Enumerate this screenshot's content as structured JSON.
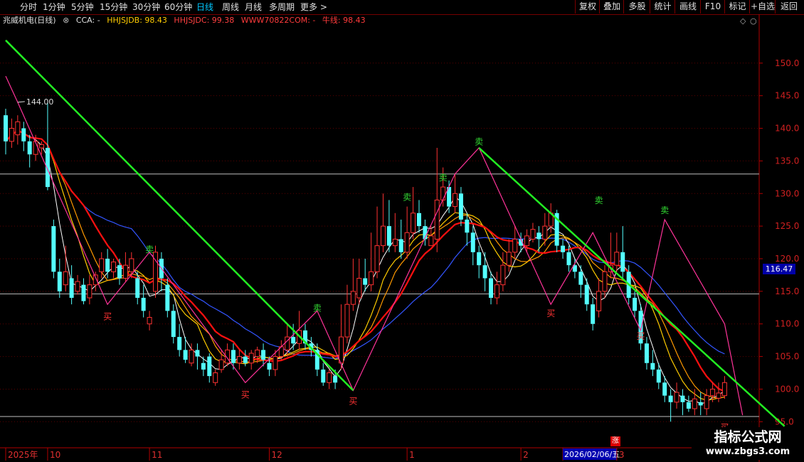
{
  "toolbar": {
    "tabs": [
      {
        "label": "分时",
        "active": false
      },
      {
        "label": "1分钟",
        "active": false
      },
      {
        "label": "5分钟",
        "active": false
      },
      {
        "label": "15分钟",
        "active": false
      },
      {
        "label": "30分钟",
        "active": false
      },
      {
        "label": "60分钟",
        "active": false
      },
      {
        "label": "日线",
        "active": true
      },
      {
        "label": "周线",
        "active": false
      },
      {
        "label": "月线",
        "active": false
      },
      {
        "label": "多周期",
        "active": false
      },
      {
        "label": "更多 >",
        "active": false
      }
    ],
    "right_buttons": [
      "复权",
      "叠加",
      "多股",
      "统计",
      "画线",
      "F10",
      "标记",
      "+自选",
      "返回"
    ]
  },
  "legend": {
    "stock": "兆威机电(日线)",
    "cca": "CCA: -",
    "hhjsjdb": "HHJSJDB: 98.43",
    "hhjsjdc": "HHJSJDC: 99.38",
    "www": "WWW70822COM: -",
    "niuxian": "牛线: 98.43"
  },
  "colors": {
    "up": "#ff3232",
    "down": "#54ffff",
    "trend_line": "#22ee22",
    "ma_red": "#ff1010",
    "ma_yellow": "#ffcc00",
    "ma_blue": "#3355ff",
    "ma_white": "#ffffff",
    "zigzag": "#ff3399",
    "axis": "#b00000"
  },
  "current_price": "116.47",
  "max_label": "144.00",
  "date_box": "2026/02/06/五",
  "zhang_badge": "涨",
  "watermark": {
    "title": "指标公式网",
    "url": "www.zbgs3.com"
  },
  "chart_data": {
    "type": "candlestick",
    "y_ticks": [
      150.0,
      145.0,
      140.0,
      135.0,
      130.0,
      125.0,
      120.0,
      115.0,
      110.0,
      105.0,
      100.0,
      95.0
    ],
    "ylim": [
      91.0,
      157.5
    ],
    "x_labels": [
      {
        "i": 0,
        "label": "2025年"
      },
      {
        "i": 7,
        "label": "10"
      },
      {
        "i": 24,
        "label": "11"
      },
      {
        "i": 44,
        "label": "12"
      },
      {
        "i": 67,
        "label": "1"
      },
      {
        "i": 86,
        "label": "2"
      },
      {
        "i": 93,
        "label": "2026/02/06/五"
      },
      {
        "i": 102,
        "label": "3"
      }
    ],
    "hlines": [
      133.0,
      114.6,
      95.8
    ],
    "candles": [
      [
        142,
        138,
        143,
        136
      ],
      [
        138,
        140,
        141.5,
        137
      ],
      [
        139,
        141,
        142,
        137.5
      ],
      [
        140,
        138,
        141,
        136.5
      ],
      [
        138,
        136,
        139,
        134
      ],
      [
        136,
        138,
        139,
        135
      ],
      [
        137,
        137.5,
        138,
        136
      ],
      [
        137,
        131,
        144,
        130.5
      ],
      [
        125,
        118,
        126,
        117
      ],
      [
        118,
        115,
        120,
        114
      ],
      [
        116,
        118,
        122,
        115
      ],
      [
        117,
        114,
        119,
        113
      ],
      [
        115,
        116.5,
        117.5,
        114.5
      ],
      [
        116,
        113.5,
        117,
        113
      ],
      [
        114,
        116,
        117.5,
        113
      ],
      [
        116,
        117.5,
        118,
        115
      ],
      [
        118,
        120,
        121,
        117
      ],
      [
        120,
        118,
        121.5,
        117
      ],
      [
        118,
        119.5,
        120,
        117
      ],
      [
        119,
        117,
        120,
        116
      ],
      [
        117,
        119,
        121,
        116.5
      ],
      [
        118,
        120,
        121,
        117
      ],
      [
        117,
        114,
        118,
        113
      ],
      [
        114,
        112,
        116,
        111
      ],
      [
        110,
        111,
        112,
        109
      ],
      [
        115,
        121,
        122,
        114
      ],
      [
        120,
        117,
        121,
        115
      ],
      [
        116,
        112,
        117,
        111
      ],
      [
        112,
        108,
        113,
        107
      ],
      [
        108,
        106,
        110,
        105
      ],
      [
        106,
        104.5,
        108,
        104
      ],
      [
        104,
        106,
        107,
        103.5
      ],
      [
        106,
        105,
        107,
        103
      ],
      [
        104,
        103,
        105,
        102
      ],
      [
        105,
        102,
        105.5,
        101
      ],
      [
        101,
        102.5,
        103,
        100.5
      ],
      [
        103,
        104.5,
        106,
        102.5
      ],
      [
        104,
        106,
        107,
        103.5
      ],
      [
        106,
        104,
        107,
        103
      ],
      [
        104,
        105,
        106,
        103
      ],
      [
        105,
        104,
        106,
        103.5
      ],
      [
        104,
        105.5,
        106,
        103
      ],
      [
        105,
        106,
        106.5,
        104
      ],
      [
        106,
        104.5,
        107,
        103.5
      ],
      [
        104,
        103,
        105,
        102
      ],
      [
        103,
        105,
        106,
        102
      ],
      [
        105,
        106.5,
        107.5,
        104.5
      ],
      [
        106,
        108,
        110,
        105
      ],
      [
        108,
        107,
        110,
        106
      ],
      [
        107,
        109,
        112,
        106
      ],
      [
        109,
        107,
        110,
        106
      ],
      [
        107,
        106,
        108,
        105
      ],
      [
        106,
        103,
        107,
        102
      ],
      [
        103,
        101,
        104,
        100.5
      ],
      [
        101,
        102.5,
        103,
        100
      ],
      [
        102,
        101,
        103,
        100
      ],
      [
        104,
        108,
        113,
        103
      ],
      [
        108,
        113,
        116,
        107
      ],
      [
        113,
        115,
        120,
        112
      ],
      [
        114,
        117,
        120,
        113
      ],
      [
        117,
        116,
        120,
        115
      ],
      [
        116,
        118,
        124,
        115
      ],
      [
        118,
        122,
        128,
        117
      ],
      [
        122,
        125,
        130,
        121
      ],
      [
        125,
        122,
        129,
        121
      ],
      [
        122,
        123,
        127,
        121
      ],
      [
        123,
        121,
        126,
        120
      ],
      [
        121,
        124,
        128,
        120
      ],
      [
        124,
        127,
        131,
        123
      ],
      [
        127,
        125,
        129,
        124
      ],
      [
        125,
        123,
        126,
        122
      ],
      [
        122,
        123.5,
        125,
        122
      ],
      [
        123,
        129,
        137,
        121
      ],
      [
        129,
        131,
        134,
        128
      ],
      [
        131,
        128,
        132,
        127
      ],
      [
        128,
        130,
        133,
        127
      ],
      [
        130,
        126,
        131,
        125
      ],
      [
        126,
        124,
        127,
        122
      ],
      [
        124,
        121,
        125,
        119
      ],
      [
        121,
        119,
        122,
        117
      ],
      [
        119,
        117,
        121,
        115
      ],
      [
        117,
        114,
        118,
        113
      ],
      [
        114,
        116,
        118,
        113
      ],
      [
        116,
        119,
        121,
        115
      ],
      [
        119,
        121,
        123,
        118
      ],
      [
        121,
        123,
        125,
        120
      ],
      [
        123,
        122,
        124,
        121
      ],
      [
        122,
        123.5,
        124.5,
        121
      ],
      [
        123,
        124.5,
        125.5,
        122.5
      ],
      [
        124,
        123,
        125,
        121
      ],
      [
        123,
        125,
        127,
        122
      ],
      [
        125,
        127,
        128.5,
        124
      ],
      [
        127,
        122,
        127.5,
        121
      ],
      [
        122,
        121,
        123,
        120
      ],
      [
        121,
        119,
        122,
        118
      ],
      [
        119,
        118,
        120,
        117
      ],
      [
        118,
        116,
        119,
        114
      ],
      [
        116,
        113,
        117,
        112
      ],
      [
        113,
        110,
        114,
        109
      ],
      [
        112,
        115,
        117,
        111
      ],
      [
        115,
        118,
        119,
        114
      ],
      [
        118,
        119,
        124,
        117
      ],
      [
        119,
        121,
        124,
        118
      ],
      [
        121,
        118,
        125,
        117
      ],
      [
        118,
        114,
        119,
        113
      ],
      [
        114,
        112,
        115,
        111
      ],
      [
        112,
        107,
        113,
        106
      ],
      [
        107,
        104,
        108,
        103
      ],
      [
        104,
        103,
        106,
        102
      ],
      [
        103,
        101,
        104,
        100
      ],
      [
        101,
        99,
        102,
        98
      ],
      [
        99,
        98,
        100,
        95
      ],
      [
        98,
        99.5,
        101,
        97
      ],
      [
        99,
        98,
        100,
        96
      ],
      [
        98,
        97,
        99,
        96.5
      ],
      [
        97,
        98.5,
        100,
        96
      ],
      [
        98,
        97.5,
        99.5,
        96
      ],
      [
        97,
        99,
        100,
        96
      ],
      [
        99,
        100,
        101,
        98
      ],
      [
        98.6,
        99.4,
        101,
        98
      ],
      [
        99,
        101,
        102,
        98.5
      ]
    ],
    "trend_lines": [
      {
        "from": [
          0,
          153.5
        ],
        "to": [
          58,
          99.8
        ]
      },
      {
        "from": [
          79,
          137
        ],
        "to": [
          130,
          94.3
        ]
      }
    ],
    "zigzag": [
      [
        0,
        148
      ],
      [
        2,
        144
      ],
      [
        17,
        113
      ],
      [
        24,
        121
      ],
      [
        40,
        101
      ],
      [
        52,
        112
      ],
      [
        58,
        99.8
      ],
      [
        75,
        133
      ],
      [
        79,
        137
      ],
      [
        91,
        113
      ],
      [
        98,
        124
      ],
      [
        106,
        109
      ],
      [
        110,
        126
      ],
      [
        120,
        110
      ],
      [
        123,
        96
      ]
    ],
    "mark_sell": [
      {
        "i": 79,
        "y": 137.5
      },
      {
        "i": 73,
        "y": 132
      },
      {
        "i": 67,
        "y": 129
      },
      {
        "i": 99,
        "y": 128.5
      },
      {
        "i": 110,
        "y": 127
      },
      {
        "i": 24,
        "y": 121
      },
      {
        "i": 52,
        "y": 112
      }
    ],
    "mark_buy": [
      {
        "i": 17,
        "y": 112
      },
      {
        "i": 40,
        "y": 100
      },
      {
        "i": 58,
        "y": 99
      },
      {
        "i": 91,
        "y": 112.5
      },
      {
        "i": 106,
        "y": 109
      },
      {
        "i": 120,
        "y": 95
      }
    ]
  }
}
